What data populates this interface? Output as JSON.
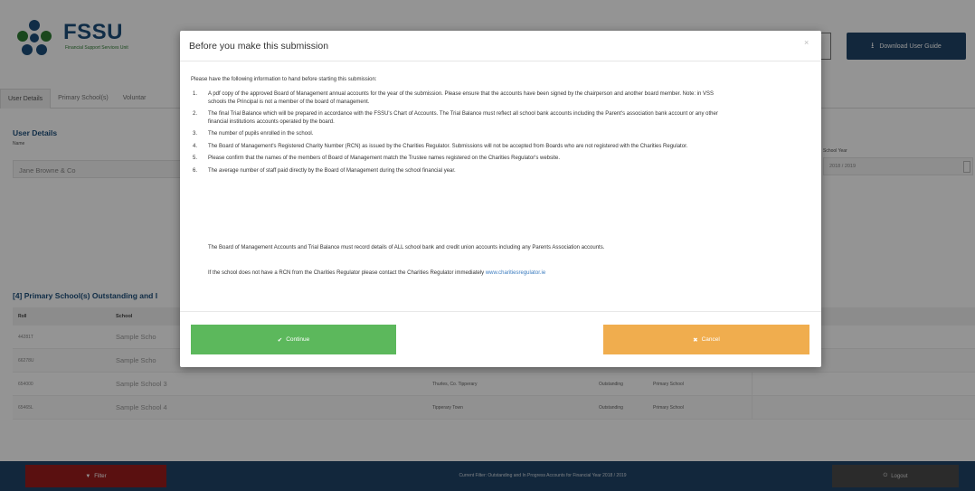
{
  "brand": {
    "name": "FSSU",
    "tagline": "Financial Support Services Unit"
  },
  "header": {
    "download_label": "Download User Guide",
    "download_icon": "download-icon"
  },
  "tabs": [
    "User Details",
    "Primary School(s)",
    "Voluntar"
  ],
  "user_details": {
    "title": "User Details",
    "name_label": "Name",
    "name_value": "Jane Browne & Co",
    "school_year_label": "School Year",
    "school_year_value": "2018 / 2019"
  },
  "schools_section": {
    "title": "[4] Primary School(s) Outstanding and I",
    "columns": [
      "Roll",
      "School"
    ],
    "rows": [
      {
        "roll": "44281T",
        "school": "Sample Scho",
        "address": "",
        "status": "",
        "type": ""
      },
      {
        "roll": "66278U",
        "school": "Sample Scho",
        "address": "",
        "status": "",
        "type": ""
      },
      {
        "roll": "654000",
        "school": "Sample School 3",
        "address": "Thurles, Co. Tipperary",
        "status": "Outstanding",
        "type": "Primary School"
      },
      {
        "roll": "65465L",
        "school": "Sample School 4",
        "address": "Tipperary Town",
        "status": "Outstanding",
        "type": "Primary School"
      }
    ]
  },
  "footer": {
    "filter_label": "Filter",
    "filter_icon": "filter-icon",
    "status_text": "Current Filter: Outstanding and In Progress Accounts for Financial Year 2018 / 2019",
    "logout_label": "Logout",
    "logout_icon": "logout-icon"
  },
  "modal": {
    "title": "Before you make this submission",
    "close_glyph": "×",
    "intro": "Please have the following information to hand before starting this submission:",
    "items": [
      {
        "num": "1.",
        "text": "A pdf copy of the approved Board of Management annual accounts for the year of the submission. Please ensure that the accounts have been signed by the chairperson and another board member. Note: in VSS schools the Principal is not a member of the board of management."
      },
      {
        "num": "2.",
        "text": "The final Trial Balance which will be prepared in accordance with the FSSU's Chart of Accounts. The Trial Balance must reflect all school bank accounts including the Parent's association bank account or any other financial institutions accounts operated by the board."
      },
      {
        "num": "3.",
        "text": "The number of pupils enrolled in the school."
      },
      {
        "num": "4.",
        "text": "The Board of Management's Registered Charity Number (RCN) as issued by the Charities Regulator. Submissions will not be accepted from Boards who are not registered with the Charities Regulator."
      },
      {
        "num": "5.",
        "text": "Please confirm that the names of the members of Board of Management match the Trustee names registered on the Charities Regulator's website."
      },
      {
        "num": "6.",
        "text": "The average number of staff paid directly by the Board of Management during the school financial year."
      }
    ],
    "note1": "The Board of Management Accounts and Trial Balance must record details of ALL school bank and credit union accounts including any Parents Association accounts.",
    "note2_prefix": "If the school does not have a RCN from the Charities Regulator please contact the Charities Regulator immediately",
    "note2_link": "www.charitiesregulator.ie",
    "continue_label": "Continue",
    "continue_icon": "check-icon",
    "cancel_label": "Cancel",
    "cancel_icon": "x-icon"
  },
  "colors": {
    "brand_blue": "#1f4468",
    "continue_green": "#5cb85c",
    "cancel_orange": "#f0ad4e",
    "filter_red": "#9b1c1c"
  }
}
